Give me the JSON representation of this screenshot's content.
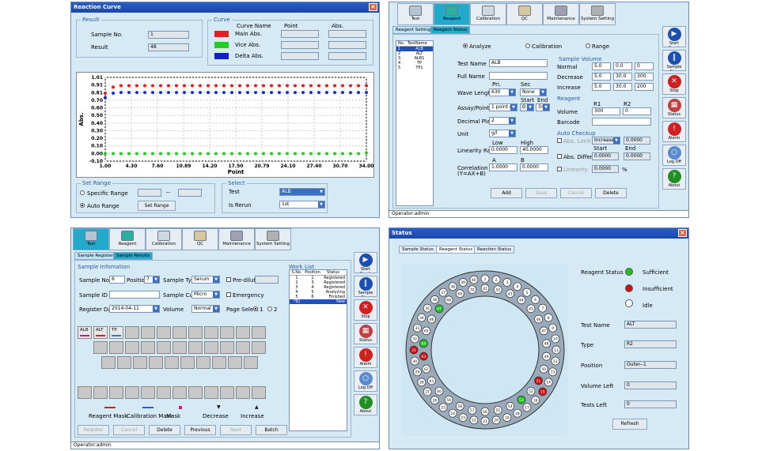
{
  "rc": {
    "title": "Reaction Curve",
    "result_group": "Result",
    "sample_no_label": "Sample No.",
    "sample_no": "1",
    "result_label": "Result",
    "result": "48",
    "curve_group": "Curve",
    "curve_headers": [
      "Curve Name",
      "Point",
      "Abs."
    ],
    "curves": [
      {
        "name": "Main Abs.",
        "color": "#e02020"
      },
      {
        "name": "Vice Abs.",
        "color": "#20d020"
      },
      {
        "name": "Delta Abs.",
        "color": "#1020d0"
      }
    ],
    "set_range_group": "Set Range",
    "specific_range": "Specific Range",
    "dash": "--",
    "auto_range": "Auto Range",
    "set_range_btn": "Set Range",
    "select_group": "Select",
    "test_label": "Test",
    "test_value": "ALB",
    "is_rerun_label": "Is Rerun",
    "is_rerun_value": "1st"
  },
  "chart_data": {
    "type": "scatter",
    "xlabel": "Point",
    "ylabel": "Abs.",
    "xticks": [
      "1.00",
      "4.30",
      "7.60",
      "10.89",
      "14.20",
      "17.50",
      "20.79",
      "24.10",
      "27.40",
      "30.70",
      "34.00"
    ],
    "yticks": [
      "1.01",
      "0.91",
      "0.81",
      "0.70",
      "0.60",
      "0.50",
      "0.40",
      "0.30",
      "0.20",
      "0.10",
      "0.00",
      "-0.10"
    ],
    "xlim": [
      1,
      34
    ],
    "ylim": [
      -0.1,
      1.01
    ],
    "series": [
      {
        "color": "#e02020",
        "values": [
          0.8,
          0.88,
          0.9,
          0.9,
          0.9,
          0.9,
          0.9,
          0.9,
          0.9,
          0.9,
          0.9,
          0.9,
          0.9,
          0.9,
          0.9,
          0.9,
          0.9,
          0.9,
          0.9,
          0.9,
          0.9,
          0.9,
          0.9,
          0.9,
          0.9,
          0.9,
          0.9,
          0.9,
          0.9,
          0.9,
          0.9,
          0.9,
          0.9,
          0.9
        ]
      },
      {
        "color": "#1030d0",
        "values": [
          0.74,
          0.8,
          0.81,
          0.81,
          0.81,
          0.81,
          0.81,
          0.81,
          0.81,
          0.81,
          0.81,
          0.81,
          0.81,
          0.81,
          0.81,
          0.81,
          0.81,
          0.81,
          0.81,
          0.81,
          0.81,
          0.81,
          0.81,
          0.81,
          0.81,
          0.81,
          0.81,
          0.81,
          0.81,
          0.81,
          0.81,
          0.81,
          0.81,
          0.81
        ]
      },
      {
        "color": "#20d020",
        "values": [
          0.0,
          0.0,
          0.0,
          0.0,
          0.0,
          0.0,
          0.0,
          0.0,
          0.0,
          0.0,
          0.0,
          0.0,
          0.0,
          0.0,
          0.0,
          0.0,
          0.0,
          0.0,
          0.0,
          0.0,
          0.0,
          0.0,
          0.0,
          0.0,
          0.0,
          0.0,
          0.0,
          0.0,
          0.0,
          0.0,
          0.0,
          0.0,
          0.0,
          0.01
        ]
      }
    ],
    "grid": true
  },
  "tabs": [
    {
      "label": "Test",
      "color": "#b8c4d0"
    },
    {
      "label": "Reagent",
      "color": "#2ab0a0"
    },
    {
      "label": "Calibration",
      "color": "#d0d8e0"
    },
    {
      "label": "QC",
      "color": "#d8c8a0"
    },
    {
      "label": "Maintenance",
      "color": "#a0a0b0"
    },
    {
      "label": "System Setting",
      "color": "#b0b0b0"
    }
  ],
  "side": [
    {
      "label": "Start Cond.",
      "glyph": "▶",
      "color": "#1a50b0"
    },
    {
      "label": "Sample Stop",
      "glyph": "‖",
      "color": "#1a50b0"
    },
    {
      "label": "Stop",
      "glyph": "✕",
      "color": "#d02020"
    },
    {
      "label": "Status",
      "glyph": "▦",
      "color": "#c04040"
    },
    {
      "label": "Alarm",
      "glyph": "!",
      "color": "#d02020"
    },
    {
      "label": "Log Off",
      "glyph": "○",
      "color": "#5a8ad0"
    },
    {
      "label": "About",
      "glyph": "?",
      "color": "#209020"
    }
  ],
  "reagent": {
    "subtabs": [
      "Reagent Settings",
      "Reagent Status"
    ],
    "list_headers": [
      "No.",
      "TestName"
    ],
    "list": [
      {
        "no": "1",
        "name": "ALB"
      },
      {
        "no": "2",
        "name": "ALT"
      },
      {
        "no": "3",
        "name": "ALB1"
      },
      {
        "no": "4",
        "name": "TP"
      },
      {
        "no": "5",
        "name": "TP1"
      }
    ],
    "radios": [
      "Analyze",
      "Calibration",
      "Range"
    ],
    "test_name_label": "Test Name",
    "test_name": "ALB",
    "full_name_label": "Full Name",
    "full_name": "",
    "pri": "Pri.",
    "sec": "Sec",
    "wave_label": "Wave Length",
    "wave_pri": "630",
    "wave_sec": "None",
    "start": "Start",
    "end": "End",
    "assay_label": "Assay/Point",
    "assay": "1 point end",
    "assay_start": "0",
    "assay_end": "34",
    "decimal_label": "Decimal Place",
    "decimal": "2",
    "unit_label": "Unit",
    "unit": "g/l",
    "low": "Low",
    "high": "High",
    "lin_label": "Linearity Range",
    "lin_low": "0.0000",
    "lin_high": "40.0000",
    "a": "A",
    "b": "B",
    "corr_label": "Correlation",
    "corr_sub": "(Y=AX+B)",
    "corr_a": "1.0000",
    "corr_b": "0.0000",
    "sv_title": "Sample Volume",
    "sv_rows": [
      {
        "label": "Normal",
        "v": [
          "5.0",
          "0.0",
          "0"
        ]
      },
      {
        "label": "Decrease",
        "v": [
          "5.0",
          "30.0",
          "300"
        ]
      },
      {
        "label": "Increase",
        "v": [
          "5.0",
          "30.0",
          "200"
        ]
      }
    ],
    "reagent_title": "Reagent",
    "r1": "R1",
    "r2": "R2",
    "volume_label": "Volume",
    "r1v": "300",
    "r2v": "0",
    "barcode_label": "Barcode",
    "ac_title": "Auto Checkup",
    "abs_limit": "Abs. Limit",
    "abs_limit_sel": "Increase",
    "abs_limit_val": "0.0000",
    "abs_diff": "Abs. Difference",
    "abs_diff_s": "0.0000",
    "abs_diff_e": "0.0000",
    "linearity": "Linearity",
    "linearity_val": "0.0000",
    "pct": "%",
    "buttons": [
      "Add",
      "Save",
      "Cancel",
      "Delete"
    ],
    "operator": "Operator:admin"
  },
  "test": {
    "subtabs": [
      "Sample Register",
      "Sample Results"
    ],
    "info_title": "Sample Infomation",
    "sample_no_label": "Sample No.",
    "sample_no": "6",
    "position_label": "Position",
    "position": "7",
    "sample_type_label": "Sample Type",
    "sample_type": "Serum",
    "predilution": "Pre-dilution",
    "sample_id_label": "Sample ID",
    "sample_cup_label": "Sample Cup",
    "sample_cup": "Micro",
    "emergency": "Emergency",
    "reg_date_label": "Register Date",
    "reg_date": "2014-04-11",
    "volume_label": "Volume",
    "volume": "Normal",
    "page_select": "Page Select",
    "p1": "1",
    "p2": "2",
    "test_keys": [
      "ALB",
      "ALT",
      "TP"
    ],
    "legend": [
      "Reagent Mask",
      "Calibration Mask",
      "Mask",
      "Decrease",
      "Increase"
    ],
    "buttons": [
      "Register",
      "Cancel",
      "Delete",
      "Previous",
      "Next",
      "Batch"
    ],
    "wl_title": "Work List",
    "wl_headers": [
      "S.No.",
      "Position",
      "Status"
    ],
    "wl_rows": [
      [
        "1",
        "1",
        "Registered"
      ],
      [
        "2",
        "3",
        "Registered"
      ],
      [
        "3",
        "4",
        "Registered"
      ],
      [
        "4",
        "5",
        "Analyzing"
      ],
      [
        "5",
        "6",
        "Finished"
      ],
      [
        "*6]",
        "",
        "New"
      ]
    ],
    "operator": "Operator:admin"
  },
  "status": {
    "title": "Status",
    "subtabs": [
      "Sample Status",
      "Reagent Status",
      "Reaction Status"
    ],
    "legend": [
      {
        "label": "Reagent Status",
        "color": ""
      },
      {
        "label": "Sufficient",
        "color": "#20c020"
      },
      {
        "label": "Insufficient",
        "color": "#d01010"
      },
      {
        "label": "Idle",
        "color": "#ffffff"
      }
    ],
    "test_name_label": "Test Name",
    "test_name": "ALT",
    "type_label": "Type",
    "type": "R2",
    "position_label": "Position",
    "position": "Outer--1",
    "vol_left_label": "Volume Left",
    "vol_left": "0",
    "tests_left_label": "Tests Left",
    "tests_left": "0",
    "refresh": "Refresh"
  }
}
